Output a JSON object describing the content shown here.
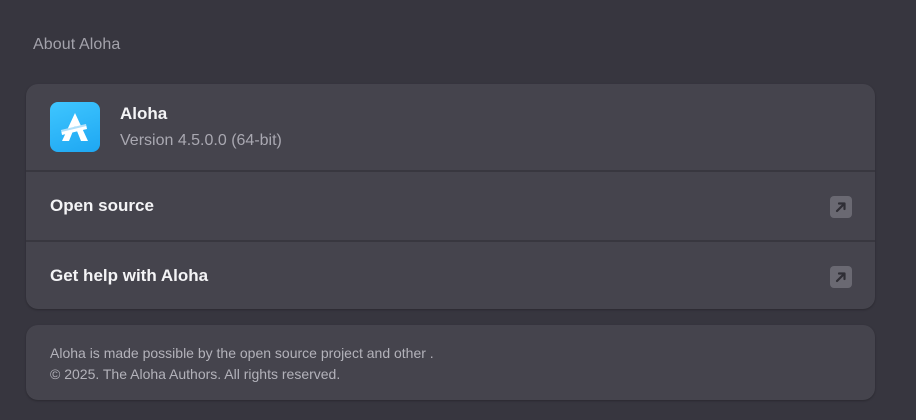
{
  "section": {
    "title": "About Aloha"
  },
  "app": {
    "name": "Aloha",
    "version": "Version 4.5.0.0 (64-bit)",
    "icon": "aloha-logo-icon",
    "accent_color": "#2ab4f8"
  },
  "links": [
    {
      "label": "Open source",
      "icon": "external-link-icon"
    },
    {
      "label": "Get help with Aloha",
      "icon": "external-link-icon"
    }
  ],
  "footer": {
    "line1": "Aloha is made possible by the open source project and other .",
    "line2": "© 2025. The Aloha Authors. All rights reserved."
  }
}
